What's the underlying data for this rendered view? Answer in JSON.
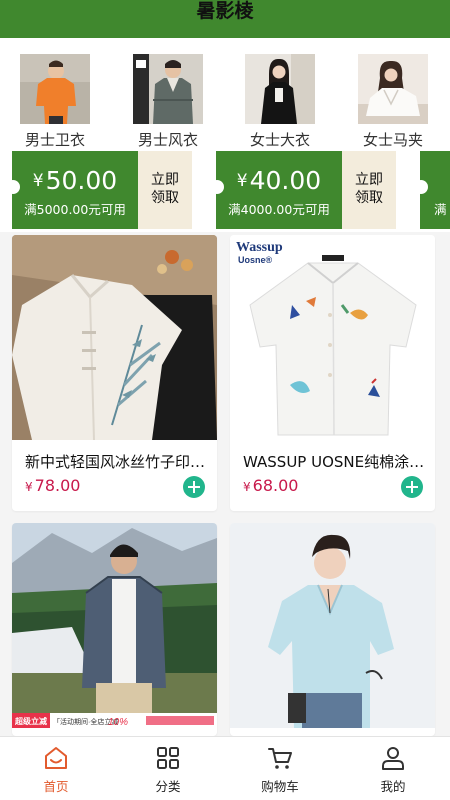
{
  "header": {
    "title": "暑影棱"
  },
  "categories": [
    {
      "label": "男士卫衣",
      "icon": "orange-shirt-man-photo"
    },
    {
      "label": "男士风衣",
      "icon": "jacket-man-photo"
    },
    {
      "label": "女士大衣",
      "icon": "black-coat-woman-photo"
    },
    {
      "label": "女士马夹",
      "icon": "white-vest-woman-photo"
    }
  ],
  "coupons": [
    {
      "symbol": "¥",
      "amount": "50.00",
      "condition": "满5000.00元可用",
      "claim_line1": "立即",
      "claim_line2": "领取"
    },
    {
      "symbol": "¥",
      "amount": "40.00",
      "condition": "满4000.00元可用",
      "claim_line1": "立即",
      "claim_line2": "领取"
    },
    {
      "partial_text": "满"
    }
  ],
  "products": [
    {
      "name": "新中式轻国风冰丝竹子印花衬衫",
      "symbol": "¥",
      "price": "78.00",
      "image": "bamboo-print-shirt-photo"
    },
    {
      "name": "WASSUP UOSNE纯棉涂鸦短袖衬衫",
      "symbol": "¥",
      "price": "68.00",
      "image": "graffiti-white-shirt-photo",
      "brand_line1": "Wassup",
      "brand_line2": "Uosne®"
    },
    {
      "image": "denim-shirt-model-photo",
      "banner_left": "超级立减",
      "banner_mid": "「活动期间·全店立减",
      "banner_pct": "10%"
    },
    {
      "image": "light-blue-shirt-model-photo"
    }
  ],
  "tabs": [
    {
      "label": "首页",
      "icon": "home-icon",
      "active": true
    },
    {
      "label": "分类",
      "icon": "category-grid-icon",
      "active": false
    },
    {
      "label": "购物车",
      "icon": "cart-icon",
      "active": false
    },
    {
      "label": "我的",
      "icon": "profile-icon",
      "active": false
    }
  ],
  "colors": {
    "brand_green": "#40882e",
    "price_red": "#c8194b",
    "add_button": "#21b58c",
    "tab_active": "#e25b2e",
    "coupon_claim_bg": "#f3ecdc"
  }
}
